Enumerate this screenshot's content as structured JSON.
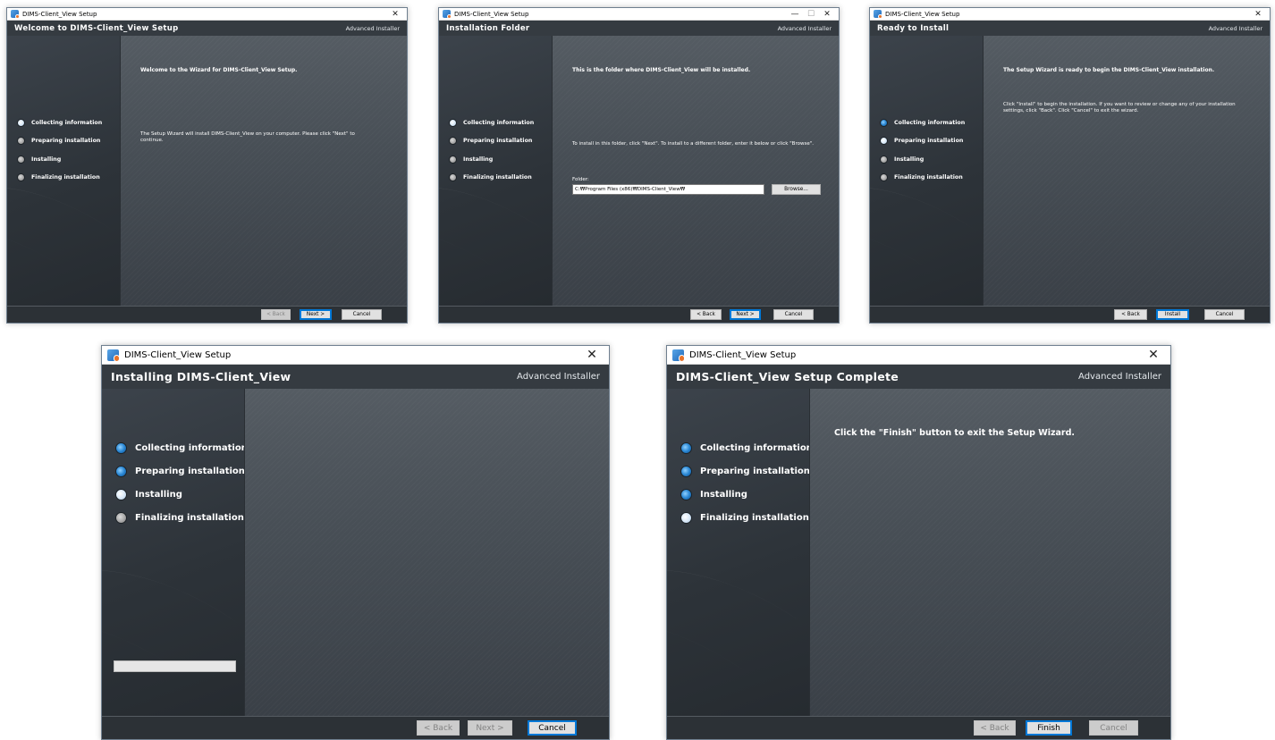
{
  "common": {
    "window_title": "DIMS-Client_View Setup",
    "brand": "Advanced Installer",
    "close_glyph": "✕",
    "minimize_glyph": "—",
    "maximize_glyph": "☐",
    "steps": [
      "Collecting information",
      "Preparing installation",
      "Installing",
      "Finalizing installation"
    ]
  },
  "windows": [
    {
      "header": "Welcome to DIMS-Client_View Setup",
      "step_states": [
        "current",
        "pending",
        "pending",
        "pending"
      ],
      "intro_bold": "Welcome to the Wizard for DIMS-Client_View Setup.",
      "intro_text": "The Setup Wizard will install DIMS-Client_View on your computer.  Please click \"Next\" to continue.",
      "buttons": {
        "back": "< Back",
        "next": "Next >",
        "cancel": "Cancel"
      },
      "button_states": {
        "back": "disabled",
        "next": "default",
        "cancel": "normal"
      }
    },
    {
      "header": "Installation Folder",
      "step_states": [
        "current",
        "pending",
        "pending",
        "pending"
      ],
      "intro_bold": "This is the folder where DIMS-Client_View will be installed.",
      "intro_text": "To install in this folder, click \"Next\". To install to a different folder, enter it below or click \"Browse\".",
      "folder_label": "Folder:",
      "folder_value": "C:₩Program Files (x86)₩DIMS-Client_View₩",
      "browse": "Browse...",
      "buttons": {
        "back": "< Back",
        "next": "Next >",
        "cancel": "Cancel"
      },
      "button_states": {
        "back": "normal",
        "next": "default",
        "cancel": "normal"
      }
    },
    {
      "header": "Ready to Install",
      "step_states": [
        "done",
        "current",
        "pending",
        "pending"
      ],
      "intro_bold": "The Setup Wizard is ready to begin the DIMS-Client_View installation.",
      "intro_text": "Click \"Install\" to begin the installation.  If you want to review or change any of your installation settings, click \"Back\".  Click \"Cancel\" to exit the wizard.",
      "buttons": {
        "back": "< Back",
        "next": "Install",
        "cancel": "Cancel"
      },
      "button_states": {
        "back": "normal",
        "next": "default",
        "cancel": "normal"
      }
    },
    {
      "header": "Installing DIMS-Client_View",
      "step_states": [
        "done",
        "done",
        "current",
        "pending"
      ],
      "progress_fraction": 0,
      "buttons": {
        "back": "< Back",
        "next": "Next >",
        "cancel": "Cancel"
      },
      "button_states": {
        "back": "disabled",
        "next": "disabled",
        "cancel": "default"
      }
    },
    {
      "header": "DIMS-Client_View Setup Complete",
      "step_states": [
        "done",
        "done",
        "done",
        "current"
      ],
      "intro_bold": "Click the \"Finish\" button to exit the Setup Wizard.",
      "buttons": {
        "back": "< Back",
        "next": "Finish",
        "cancel": "Cancel"
      },
      "button_states": {
        "back": "disabled",
        "next": "default",
        "cancel": "disabled"
      }
    }
  ]
}
